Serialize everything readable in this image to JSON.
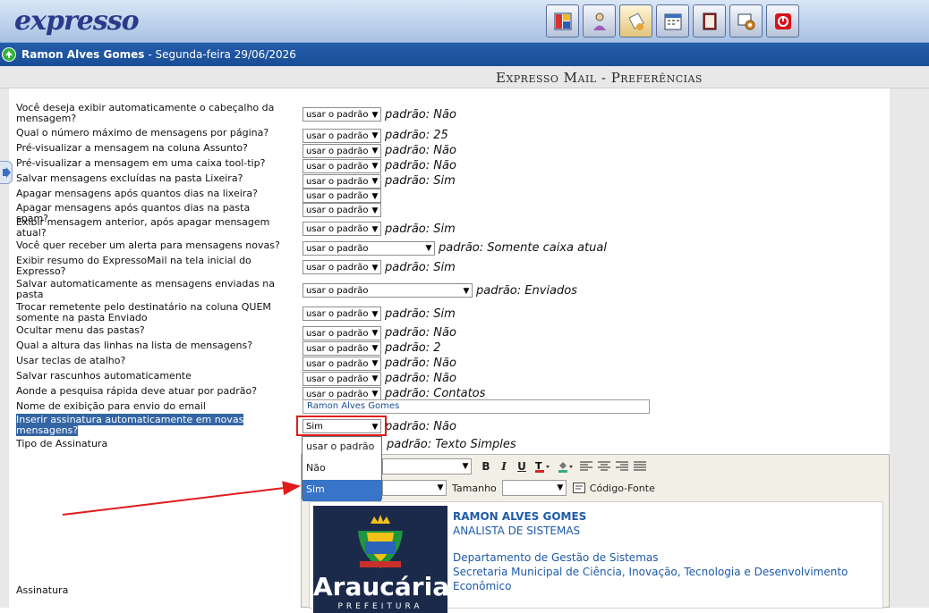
{
  "app": {
    "logo": "expresso",
    "user_name": "Ramon Alves Gomes",
    "date_text": "- Segunda-feira 29/06/2026",
    "page_title": "Expresso Mail - Preferências"
  },
  "toolbar": {
    "icons": [
      "layout-icon",
      "contacts-icon",
      "mail-icon",
      "calendar-icon",
      "notebook-icon",
      "admin-icon",
      "logout-icon"
    ]
  },
  "preferences": [
    {
      "label": "Você deseja exibir automaticamente o cabeçalho da mensagem?",
      "select": "usar o padrão",
      "default": "padrão: Não"
    },
    {
      "label": "Qual o número máximo de mensagens por página?",
      "select": "usar o padrão",
      "default": "padrão: 25"
    },
    {
      "label": "Pré-visualizar a mensagem na coluna Assunto?",
      "select": "usar o padrão",
      "default": "padrão: Não"
    },
    {
      "label": "Pré-visualizar a mensagem em uma caixa tool-tip?",
      "select": "usar o padrão",
      "default": "padrão: Não"
    },
    {
      "label": "Salvar mensagens excluídas na pasta Lixeira?",
      "select": "usar o padrão",
      "default": "padrão: Sim"
    },
    {
      "label": "Apagar mensagens após quantos dias na lixeira?",
      "select": "usar o padrão",
      "default": ""
    },
    {
      "label": "Apagar mensagens após quantos dias na pasta spam?",
      "select": "usar o padrão",
      "default": ""
    },
    {
      "label": "Exibir mensagem anterior, após apagar mensagem atual?",
      "select": "usar o padrão",
      "default": "padrão: Sim"
    },
    {
      "label": "Você quer receber um alerta para mensagens novas?",
      "select": "usar o padrão",
      "default": "padrão: Somente caixa atual"
    },
    {
      "label": "Exibir resumo do ExpressoMail na tela inicial do Expresso?",
      "select": "usar o padrão",
      "default": "padrão: Sim"
    },
    {
      "label": "Salvar automaticamente as mensagens enviadas na pasta",
      "select": "usar o padrão",
      "default": "padrão: Enviados"
    },
    {
      "label": "Trocar remetente pelo destinatário na coluna QUEM somente na pasta Enviado",
      "select": "usar o padrão",
      "default": "padrão: Sim"
    },
    {
      "label": "Ocultar menu das pastas?",
      "select": "usar o padrão",
      "default": "padrão: Não"
    },
    {
      "label": "Qual a altura das linhas na lista de mensagens?",
      "select": "usar o padrão",
      "default": "padrão: 2"
    },
    {
      "label": "Usar teclas de atalho?",
      "select": "usar o padrão",
      "default": "padrão: Não"
    },
    {
      "label": "Salvar rascunhos automaticamente",
      "select": "usar o padrão",
      "default": "padrão: Não"
    },
    {
      "label": "Aonde a pesquisa rápida deve atuar por padrão?",
      "select": "usar o padrão",
      "default": "padrão: Contatos"
    }
  ],
  "display_name": {
    "label": "Nome de exibição para envio do email",
    "value": "Ramon Alves Gomes"
  },
  "signature_auto": {
    "label": "Inserir assinatura automaticamente em novas mensagens?",
    "select": "Sim",
    "default": "padrão: Não"
  },
  "signature_type": {
    "label": "Tipo de Assinatura",
    "default": "padrão: Texto Simples"
  },
  "dropdown_options": [
    "usar o padrão",
    "Não",
    "Sim"
  ],
  "dropdown_selected": "Sim",
  "editor": {
    "size_label": "Tamanho",
    "source_label": "Código-Fonte",
    "bold": "B",
    "italic": "I",
    "underline": "U"
  },
  "signature": {
    "label": "Assinatura",
    "logo_text": "Araucária",
    "logo_sub": "PREFEITURA",
    "name": "RAMON ALVES GOMES",
    "role": "ANALISTA DE SISTEMAS",
    "dept": "Departamento de Gestão de Sistemas",
    "sec_line1": "Secretaria Municipal de Ciência, Inovação, Tecnologia e Desenvolvimento",
    "sec_line2": "Econômico"
  }
}
